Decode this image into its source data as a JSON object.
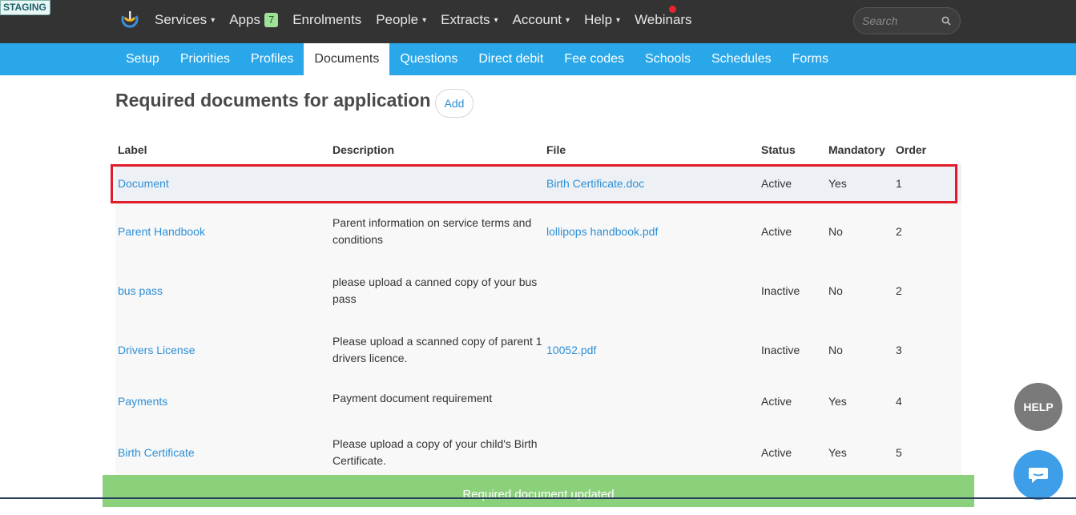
{
  "env_badge": "STAGING",
  "nav": {
    "items": [
      {
        "label": "Services",
        "caret": true
      },
      {
        "label": "Apps",
        "badge": "7"
      },
      {
        "label": "Enrolments"
      },
      {
        "label": "People",
        "caret": true
      },
      {
        "label": "Extracts",
        "caret": true
      },
      {
        "label": "Account",
        "caret": true
      },
      {
        "label": "Help",
        "caret": true
      },
      {
        "label": "Webinars"
      }
    ],
    "search_placeholder": "Search"
  },
  "subnav": {
    "tabs": [
      "Setup",
      "Priorities",
      "Profiles",
      "Documents",
      "Questions",
      "Direct debit",
      "Fee codes",
      "Schools",
      "Schedules",
      "Forms"
    ],
    "active": "Documents"
  },
  "page": {
    "title": "Required documents for application",
    "add_label": "Add"
  },
  "table": {
    "headers": [
      "Label",
      "Description",
      "File",
      "Status",
      "Mandatory",
      "Order"
    ],
    "rows": [
      {
        "label": "Document",
        "description": "",
        "file": "Birth Certificate.doc",
        "status": "Active",
        "mandatory": "Yes",
        "order": "1"
      },
      {
        "label": "Parent Handbook",
        "description": "Parent information on service terms and conditions",
        "file": "lollipops handbook.pdf",
        "status": "Active",
        "mandatory": "No",
        "order": "2"
      },
      {
        "label": "bus pass",
        "description": "please upload a canned copy of your bus pass",
        "file": "",
        "status": "Inactive",
        "mandatory": "No",
        "order": "2"
      },
      {
        "label": "Drivers License",
        "description": "Please upload a scanned copy of parent 1 drivers licence.",
        "file": "10052.pdf",
        "status": "Inactive",
        "mandatory": "No",
        "order": "3"
      },
      {
        "label": "Payments",
        "description": "Payment document requirement",
        "file": "",
        "status": "Active",
        "mandatory": "Yes",
        "order": "4"
      },
      {
        "label": "Birth Certificate",
        "description": "Please upload a copy of your child's Birth Certificate.",
        "file": "",
        "status": "Active",
        "mandatory": "Yes",
        "order": "5"
      }
    ]
  },
  "help_label": "HELP",
  "toast": "Required document updated",
  "colors": {
    "topbar": "#333333",
    "subnav": "#29a7e8",
    "link": "#2d8fd6",
    "highlight": "#e01b2a",
    "toast": "#8bd17c"
  }
}
